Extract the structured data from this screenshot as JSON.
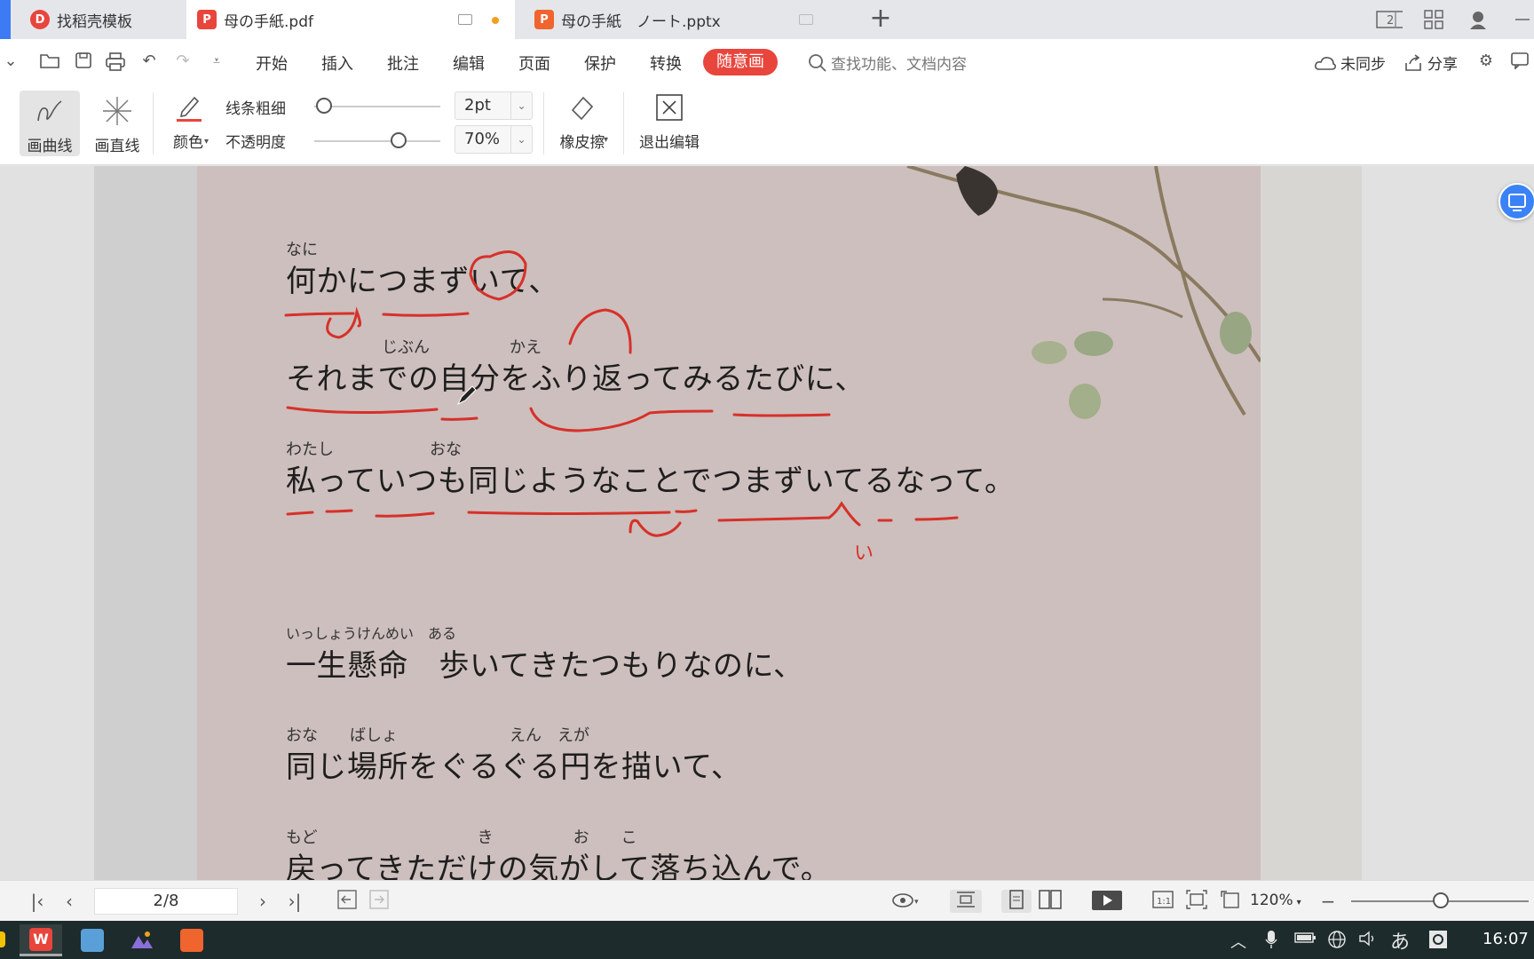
{
  "tabs": [
    {
      "label": "找稻壳模板",
      "icon": "docer-icon"
    },
    {
      "label": "母の手紙.pdf",
      "icon": "pdf-icon"
    },
    {
      "label": "母の手紙　ノート.pptx",
      "icon": "pptx-icon"
    }
  ],
  "menu": {
    "items": [
      "开始",
      "插入",
      "批注",
      "编辑",
      "页面",
      "保护",
      "转换"
    ],
    "active": "随意画",
    "search_placeholder": "查找功能、文档内容",
    "unsync": "未同步",
    "share": "分享"
  },
  "ribbon": {
    "curve": "画曲线",
    "straight": "画直线",
    "color": "颜色",
    "line_width_label": "线条粗细",
    "line_width_value": "2pt",
    "opacity_label": "不透明度",
    "opacity_value": "70%",
    "eraser": "橡皮擦",
    "exit": "退出编辑"
  },
  "document": {
    "lines": [
      {
        "ruby": "なに",
        "text": "何かにつまずいて、"
      },
      {
        "ruby": "　　　　　　じぶん　　　　　かえ",
        "text": "それまでの自分をふり返ってみるたびに、"
      },
      {
        "ruby": "わたし　　　　　　おな",
        "text": "私っていつも同じようなことでつまずいてるなって。"
      },
      {
        "ruby": "いっしょうけんめい　ある",
        "text": "一生懸命　歩いてきたつもりなのに、"
      },
      {
        "ruby": "おな　　ばしょ　　　　　　　えん　えが",
        "text": "同じ場所をぐるぐる円を描いて、"
      },
      {
        "ruby": "もど　　　　　　　　　　き　　　　　お　　こ",
        "text": "戻ってきただけの気がして落ち込んで。"
      }
    ],
    "annotation_note": "い"
  },
  "status": {
    "page": "2/8",
    "zoom": "120%"
  },
  "taskbar": {
    "time": "16:07",
    "ime": "あ"
  }
}
